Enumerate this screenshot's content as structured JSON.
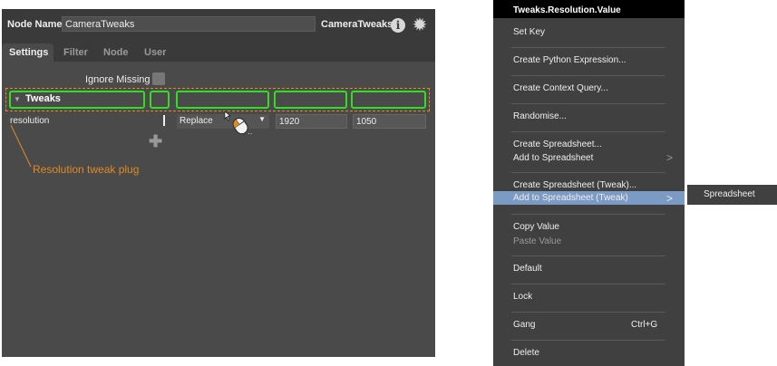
{
  "editor": {
    "node_name_label": "Node Name",
    "node_name_value": "CameraTweaks",
    "node_type": "CameraTweaks",
    "info_glyph": "i",
    "tabs": [
      "Settings",
      "Filter",
      "Node",
      "User"
    ],
    "active_tab": "Settings",
    "ignore_missing_label": "Ignore Missing",
    "tweaks_label": "Tweaks",
    "tweak_row": {
      "name": "resolution",
      "mode": "Replace",
      "value_x": "1920",
      "value_y": "1050"
    },
    "annotation": "Resolution tweak plug"
  },
  "menu": {
    "title": "Tweaks.Resolution.Value",
    "items": [
      "Set Key",
      "Create Python Expression...",
      "Create Context Query...",
      "Randomise...",
      "Create Spreadsheet...",
      "Add to Spreadsheet",
      "Create Spreadsheet (Tweak)...",
      "Add to Spreadsheet (Tweak)",
      "Copy Value",
      "Paste Value",
      "Default",
      "Lock",
      "Gang",
      "Delete"
    ],
    "gang_shortcut": "Ctrl+G",
    "submenu_item": "Spreadsheet"
  },
  "icons": [
    "info-icon",
    "gear-icon",
    "chevron-down-icon",
    "plus-icon",
    "mouse-cursor-icon",
    "chevron-right-icon"
  ],
  "colors": {
    "highlight": "#7b9ac4",
    "green_outline": "#33dd22",
    "annotation_orange": "#e08a20"
  }
}
